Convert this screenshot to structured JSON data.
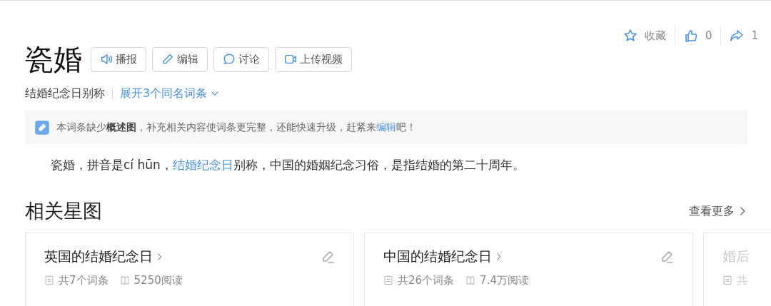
{
  "actions": [
    {
      "kind": "favorite",
      "label": "收藏"
    },
    {
      "kind": "like",
      "label": "0"
    },
    {
      "kind": "share",
      "label": "1"
    }
  ],
  "title": "瓷婚",
  "toolbar": [
    {
      "kind": "speaker",
      "label": "播报"
    },
    {
      "kind": "pencil",
      "label": "编辑"
    },
    {
      "kind": "chat",
      "label": "讨论"
    },
    {
      "kind": "video",
      "label": "上传视频"
    }
  ],
  "subtitle": "结婚纪念日别称",
  "expand_link": "展开3个同名词条",
  "notice": {
    "text": "本词条缺少**概述图**，补充相关内容使词条更完整，还能快速升级，赶紧来",
    "link": "编辑",
    "end": "吧！"
  },
  "summary": {
    "before": "瓷婚，拼音是cí hūn，",
    "link": "结婚纪念日",
    "after": "别称，中国的婚姻纪念习俗，是指结婚的第二十周年。"
  },
  "section": {
    "title": "相关星图",
    "more": "查看更多"
  },
  "cards": [
    {
      "title": "英国的结婚纪念日",
      "entries": "共7个词条",
      "reads": "5250阅读",
      "faded": false
    },
    {
      "title": "中国的结婚纪念日",
      "entries": "共26个词条",
      "reads": "7.4万阅读",
      "faded": false
    },
    {
      "title": "婚后",
      "entries": "共",
      "faded": true
    }
  ]
}
